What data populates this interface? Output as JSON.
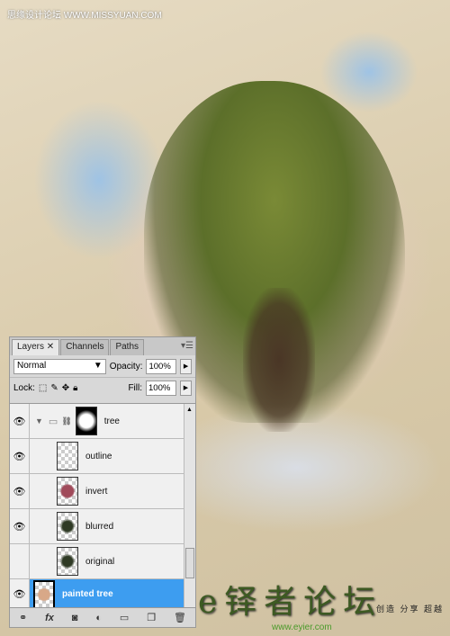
{
  "watermark": {
    "site_name": "思缘设计论坛",
    "site_url": "WWW.MISSYUAN.COM"
  },
  "footer_logo": {
    "text": "e铎者论坛",
    "url": "www.eyier.com",
    "slogan": "创造 分享 超越"
  },
  "panel": {
    "tabs": [
      {
        "label": "Layers",
        "active": true
      },
      {
        "label": "Channels"
      },
      {
        "label": "Paths"
      }
    ],
    "blend_mode": "Normal",
    "opacity_label": "Opacity:",
    "opacity": "100%",
    "lock_label": "Lock:",
    "fill_label": "Fill:",
    "fill": "100%",
    "layers": [
      {
        "name": "tree",
        "type": "group",
        "visible": true,
        "expanded": true
      },
      {
        "name": "outline",
        "visible": true
      },
      {
        "name": "invert",
        "visible": true
      },
      {
        "name": "blurred",
        "visible": true
      },
      {
        "name": "original",
        "visible": false
      },
      {
        "name": "painted tree",
        "visible": true,
        "selected": true
      }
    ],
    "selection_color": "#3d9df0",
    "footer_icons": [
      "link-icon",
      "fx-icon",
      "mask-icon",
      "adjustment-icon",
      "folder-icon",
      "new-layer-icon",
      "trash-icon"
    ]
  }
}
